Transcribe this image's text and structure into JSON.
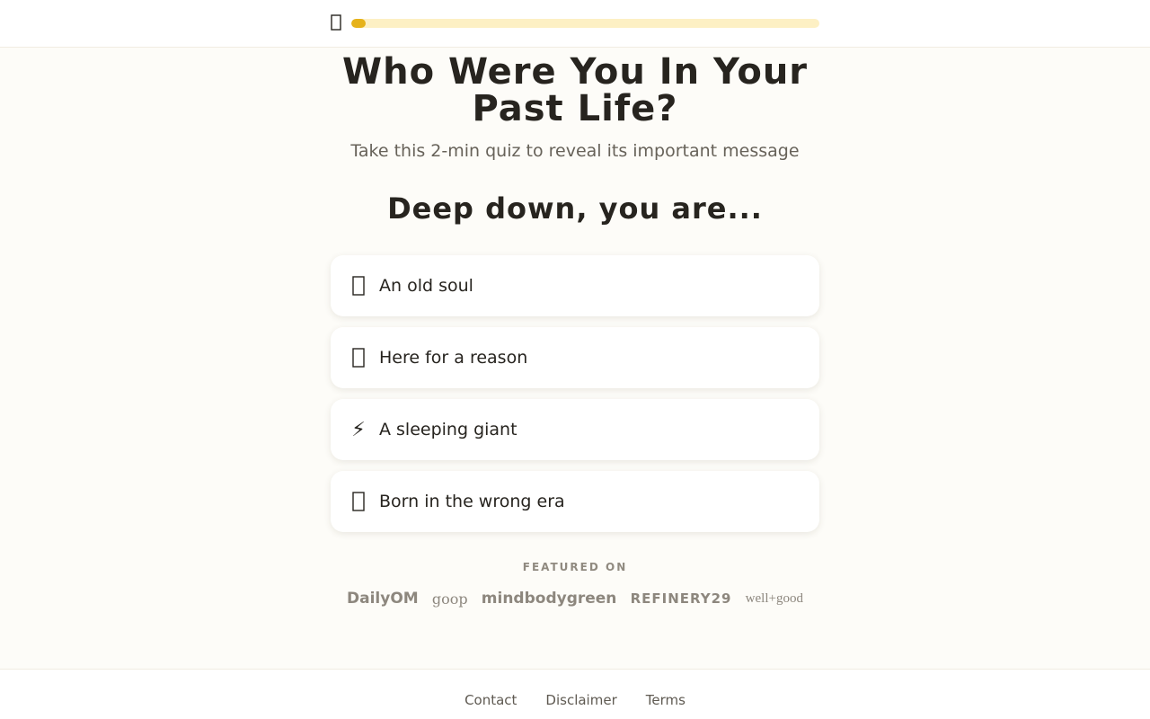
{
  "progress": {
    "fraction": 0.03,
    "fill_color": "#e6b21a",
    "track_color": "#fdf0c4"
  },
  "header": {
    "back_icon": "arrow-left-icon"
  },
  "title": "Who Were You In Your Past Life?",
  "subtitle": "Take this 2-min quiz to reveal its important message",
  "question": "Deep down, you are...",
  "options": [
    {
      "icon": "hourglass-icon",
      "label": "An old soul"
    },
    {
      "icon": "sparkle-icon",
      "label": "Here for a reason"
    },
    {
      "icon": "lightning-icon",
      "glyph": "⚡",
      "label": "A sleeping giant"
    },
    {
      "icon": "clock-icon",
      "label": "Born in the wrong era"
    }
  ],
  "featured": {
    "label": "FEATURED ON",
    "logos": [
      "DailyOM",
      "goop",
      "mindbodygreen",
      "REFINERY29",
      "well+good"
    ]
  },
  "footer": {
    "links": [
      "Contact",
      "Disclaimer",
      "Terms"
    ]
  }
}
